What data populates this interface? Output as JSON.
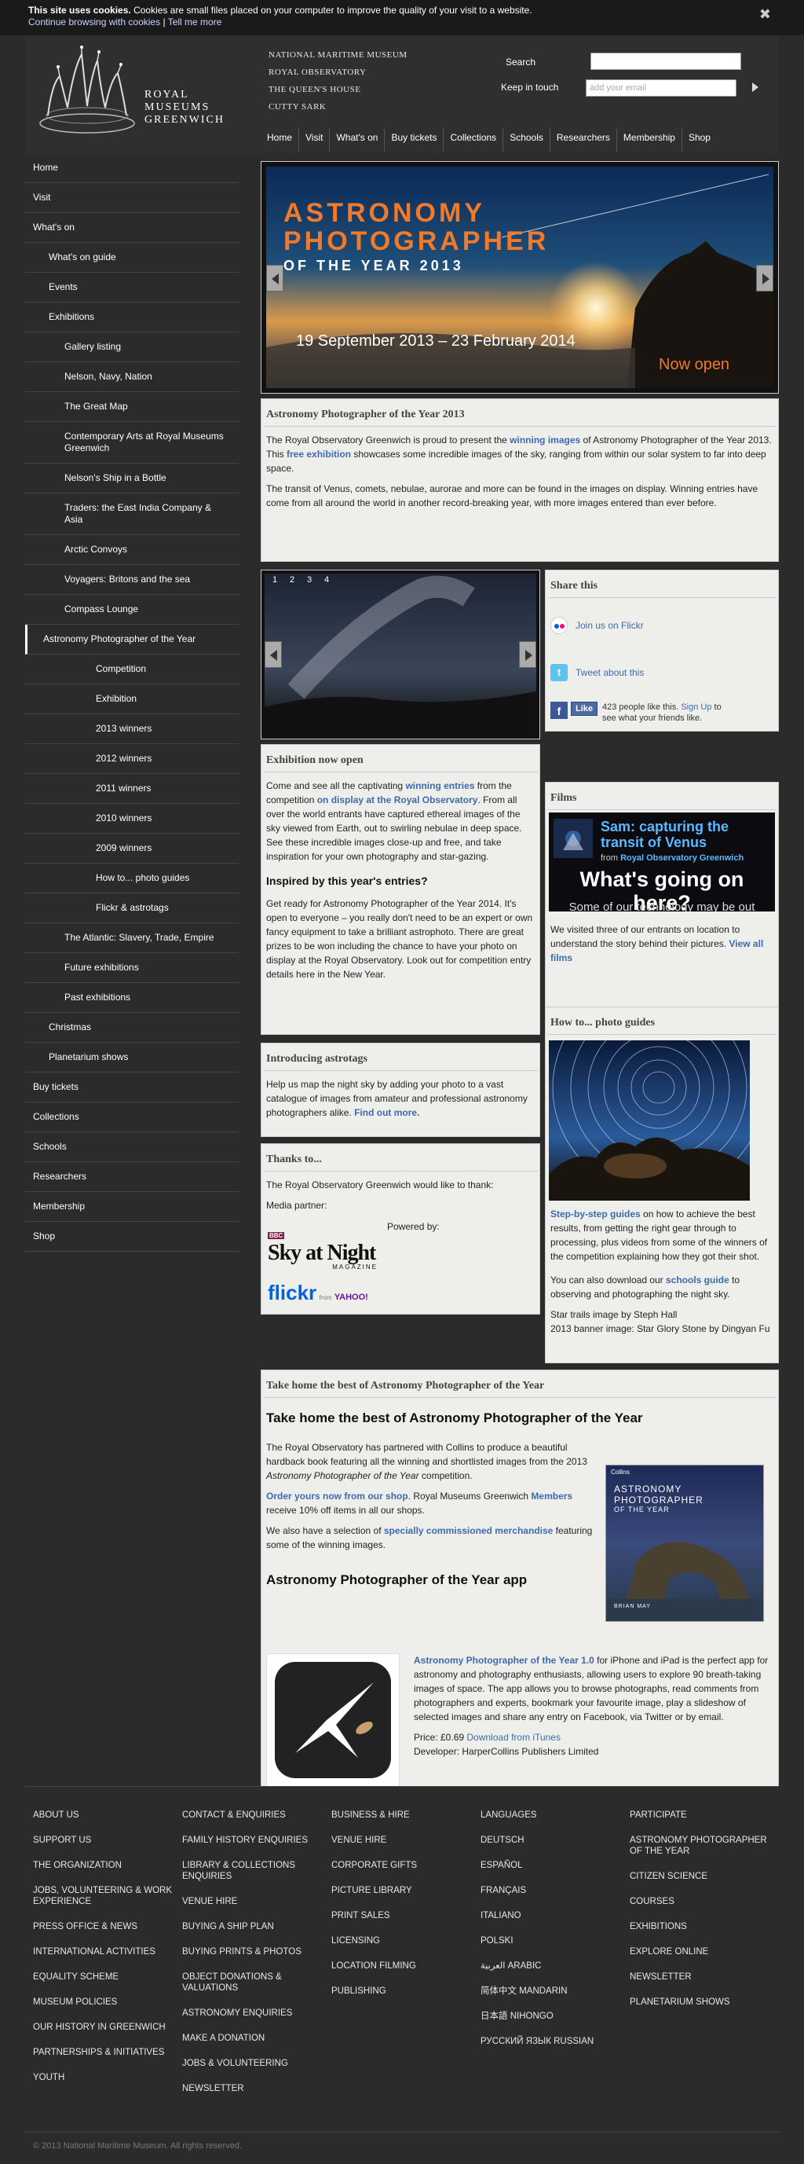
{
  "cookie": {
    "title": "This site uses cookies.",
    "text": "Cookies are small files placed on your computer to improve the quality of your visit to a website.",
    "continue_label": "Continue browsing with cookies",
    "sep": "|",
    "tell_label": "Tell me more",
    "close_label": "✖"
  },
  "header": {
    "logo_lines": [
      "ROYAL",
      "MUSEUMS",
      "GREENWICH"
    ],
    "sites": [
      "NATIONAL MARITIME MUSEUM",
      "ROYAL OBSERVATORY",
      "THE QUEEN'S HOUSE",
      "CUTTY SARK"
    ],
    "search_label": "Search",
    "keep_label": "Keep in touch",
    "email_placeholder": "add your email",
    "nav": [
      "Home",
      "Visit",
      "What's on",
      "Buy tickets",
      "Collections",
      "Schools",
      "Researchers",
      "Membership",
      "Shop"
    ]
  },
  "sidebar": [
    {
      "label": "Home",
      "level": 1
    },
    {
      "label": "Visit",
      "level": 1
    },
    {
      "label": "What's on",
      "level": 1
    },
    {
      "label": "What's on guide",
      "level": 2
    },
    {
      "label": "Events",
      "level": 2
    },
    {
      "label": "Exhibitions",
      "level": 2
    },
    {
      "label": "Gallery listing",
      "level": 3
    },
    {
      "label": "Nelson, Navy, Nation",
      "level": 3
    },
    {
      "label": "The Great Map",
      "level": 3
    },
    {
      "label": "Contemporary Arts at Royal Museums Greenwich",
      "level": 3
    },
    {
      "label": "Nelson's Ship in a Bottle",
      "level": 3
    },
    {
      "label": "Traders: the East India Company & Asia",
      "level": 3
    },
    {
      "label": "Arctic Convoys",
      "level": 3
    },
    {
      "label": "Voyagers: Britons and the sea",
      "level": 3
    },
    {
      "label": "Compass Lounge",
      "level": 3
    },
    {
      "label": "Astronomy Photographer of the Year",
      "level": 3,
      "current": true
    },
    {
      "label": "Competition",
      "level": 4
    },
    {
      "label": "Exhibition",
      "level": 4
    },
    {
      "label": "2013 winners",
      "level": 4
    },
    {
      "label": "2012 winners",
      "level": 4
    },
    {
      "label": "2011 winners",
      "level": 4
    },
    {
      "label": "2010 winners",
      "level": 4
    },
    {
      "label": "2009 winners",
      "level": 4
    },
    {
      "label": "How to... photo guides",
      "level": 4
    },
    {
      "label": "Flickr & astrotags",
      "level": 4
    },
    {
      "label": "The Atlantic: Slavery, Trade, Empire",
      "level": 3
    },
    {
      "label": "Future exhibitions",
      "level": 3
    },
    {
      "label": "Past exhibitions",
      "level": 3
    },
    {
      "label": "Christmas",
      "level": 2
    },
    {
      "label": "Planetarium shows",
      "level": 2
    },
    {
      "label": "Buy tickets",
      "level": 1
    },
    {
      "label": "Collections",
      "level": 1
    },
    {
      "label": "Schools",
      "level": 1
    },
    {
      "label": "Researchers",
      "level": 1
    },
    {
      "label": "Membership",
      "level": 1
    },
    {
      "label": "Shop",
      "level": 1
    }
  ],
  "banner": {
    "line1": "ASTRONOMY",
    "line2": "PHOTOGRAPHER",
    "line3": "OF THE YEAR 2013",
    "dates": "19 September 2013 – 23 February 2014",
    "status": "Now open"
  },
  "intro": {
    "heading": "Astronomy Photographer of the Year 2013",
    "p1_a": "The Royal Observatory Greenwich is proud to present the ",
    "p1_link": "winning images",
    "p1_b": " of Astronomy Photographer of the Year 2013. This ",
    "p1_link2": "free exhibition",
    "p1_c": " showcases some incredible images of the sky, ranging from within our solar system to far into deep space.",
    "p2": "The transit of Venus, comets, nebulae, aurorae and more can be found in the images on display. Winning entries have come from all around the world in another record-breaking year, with more images entered than ever before."
  },
  "slider": {
    "tabs": [
      "1",
      "2",
      "3",
      "4"
    ]
  },
  "share": {
    "heading": "Share this",
    "flickr": "Join us on Flickr",
    "twitter": "Tweet about this",
    "fb_like": "Like",
    "fb_text_a": "423 people like this. ",
    "fb_signup": "Sign Up",
    "fb_text_b": " to see what your friends like."
  },
  "exhibition": {
    "heading": "Exhibition now open",
    "p1_a": "Come and see all the captivating ",
    "p1_link": "winning entries",
    "p1_b": " from the competition ",
    "p1_link2": "on display at the Royal Observatory",
    "p1_c": ". From all over the world entrants have captured ethereal images of the sky viewed from Earth, out to swirling nebulae in deep space. See these incredible images close-up and free, and take inspiration for your own photography and star-gazing.",
    "subheading": "Inspired by this year's entries?",
    "p2": "Get ready for Astronomy Photographer of the Year 2014. It's open to everyone – you really don't need to be an expert or own fancy equipment to take a brilliant astrophoto. There are great prizes to be won including the chance to have your photo on display at the Royal Observatory. Look out for competition entry details here in the New Year."
  },
  "films": {
    "heading": "Films",
    "video_title": "Sam: capturing the transit of Venus",
    "video_from": "from",
    "video_channel": "Royal Observatory Greenwich",
    "video_big": "What's going on here?",
    "video_sub": "Some of our technology may be out",
    "text_a": "We visited three of our entrants on location to understand the story behind their pictures. ",
    "link": "View all films"
  },
  "astrotags": {
    "heading": "Introducing astrotags",
    "text_a": "Help us map the night sky by adding your photo to a vast catalogue of images from amateur and professional astronomy photographers alike. ",
    "link": "Find out more."
  },
  "guides": {
    "heading": "How to... photo guides",
    "link1": "Step-by-step guides",
    "text1": " on how to achieve the best results, from getting the right gear through to processing, plus videos from some of the winners of the competition explaining how they got their shot.",
    "text2_a": "You can also download our ",
    "link2": "schools guide",
    "text2_b": " to observing and photographing the night sky.",
    "credit1": "Star trails image by Steph Hall",
    "credit2": "2013 banner image: Star Glory Stone by Dingyan Fu"
  },
  "thanks": {
    "heading": "Thanks to...",
    "p1": "The Royal Observatory Greenwich would like to thank:",
    "media": "Media partner:",
    "powered": "Powered by:",
    "sky_bbc": "BBC",
    "sky_line1": "Sky at Night",
    "sky_line2": "MAGAZINE",
    "flickr_logo": "flickr",
    "flickr_from": "from",
    "yahoo": "YAHOO!"
  },
  "book": {
    "band_heading": "Take home the best of Astronomy Photographer of the Year",
    "heading": "Take home the best of Astronomy Photographer of the Year",
    "p1_a": "The Royal Observatory has partnered with Collins to produce a beautiful hardback book featuring all the winning and shortlisted images from the 2013 ",
    "p1_em": "Astronomy Photographer of the Year",
    "p1_b": " competition.",
    "p2_link": "Order yours now from our shop",
    "p2_a": ". Royal Museums Greenwich ",
    "p2_link2": "Members",
    "p2_b": " receive 10% off items in all our shops.",
    "p3_a": "We also have a selection of ",
    "p3_link": "specially commissioned merchandise",
    "p3_b": " featuring some of the winning images.",
    "cover_pub": "Collins",
    "cover_t1": "ASTRONOMY",
    "cover_t2": "PHOTOGRAPHER",
    "cover_t3": "OF THE YEAR",
    "cover_author": "BRIAN MAY",
    "app_heading": "Astronomy Photographer of the Year app",
    "app_link": "Astronomy Photographer of the Year 1.0",
    "app_text": " for iPhone and iPad is the perfect app for astronomy and photography enthusiasts, allowing users to explore 90 breath-taking images of space. The app allows you to browse photographs, read comments from photographers and experts, bookmark your favourite image, play a slideshow of selected images and share any entry on Facebook, via Twitter or by email.",
    "price_a": "Price: £0.69 ",
    "price_link": "Download from iTunes",
    "developer": "Developer: HarperCollins Publishers Limited"
  },
  "footer": {
    "col1": [
      "ABOUT US",
      "SUPPORT US",
      "THE ORGANIZATION",
      "JOBS, VOLUNTEERING & WORK EXPERIENCE",
      "PRESS OFFICE & NEWS",
      "INTERNATIONAL ACTIVITIES",
      "EQUALITY SCHEME",
      "MUSEUM POLICIES",
      "OUR HISTORY IN GREENWICH",
      "PARTNERSHIPS & INITIATIVES",
      "YOUTH"
    ],
    "col2": [
      "CONTACT & ENQUIRIES",
      "FAMILY HISTORY ENQUIRIES",
      "LIBRARY & COLLECTIONS ENQUIRIES",
      "VENUE HIRE",
      "BUYING A SHIP PLAN",
      "BUYING PRINTS & PHOTOS",
      "OBJECT DONATIONS & VALUATIONS",
      "ASTRONOMY ENQUIRIES",
      "MAKE A DONATION",
      "JOBS & VOLUNTEERING",
      "NEWSLETTER"
    ],
    "col3": [
      "BUSINESS & HIRE",
      "VENUE HIRE",
      "CORPORATE GIFTS",
      "PICTURE LIBRARY",
      "PRINT SALES",
      "LICENSING",
      "LOCATION FILMING",
      "PUBLISHING"
    ],
    "col4": [
      "LANGUAGES",
      "DEUTSCH",
      "ESPAÑOL",
      "FRANÇAIS",
      "ITALIANO",
      "POLSKI",
      "العربية ARABIC",
      "简体中文 MANDARIN",
      "日本語 NIHONGO",
      "РУССКИЙ ЯЗЫК RUSSIAN"
    ],
    "col5": [
      "PARTICIPATE",
      "ASTRONOMY PHOTOGRAPHER OF THE YEAR",
      "CITIZEN SCIENCE",
      "COURSES",
      "EXHIBITIONS",
      "EXPLORE ONLINE",
      "NEWSLETTER",
      "PLANETARIUM SHOWS"
    ],
    "copyright": "© 2013 National Maritime Museum. All rights reserved."
  },
  "colors": {
    "link": "#3e6bb0",
    "accent_orange": "#f07a2a",
    "panel_bg": "#eeeeea",
    "page_bg": "#2b2b2b"
  }
}
